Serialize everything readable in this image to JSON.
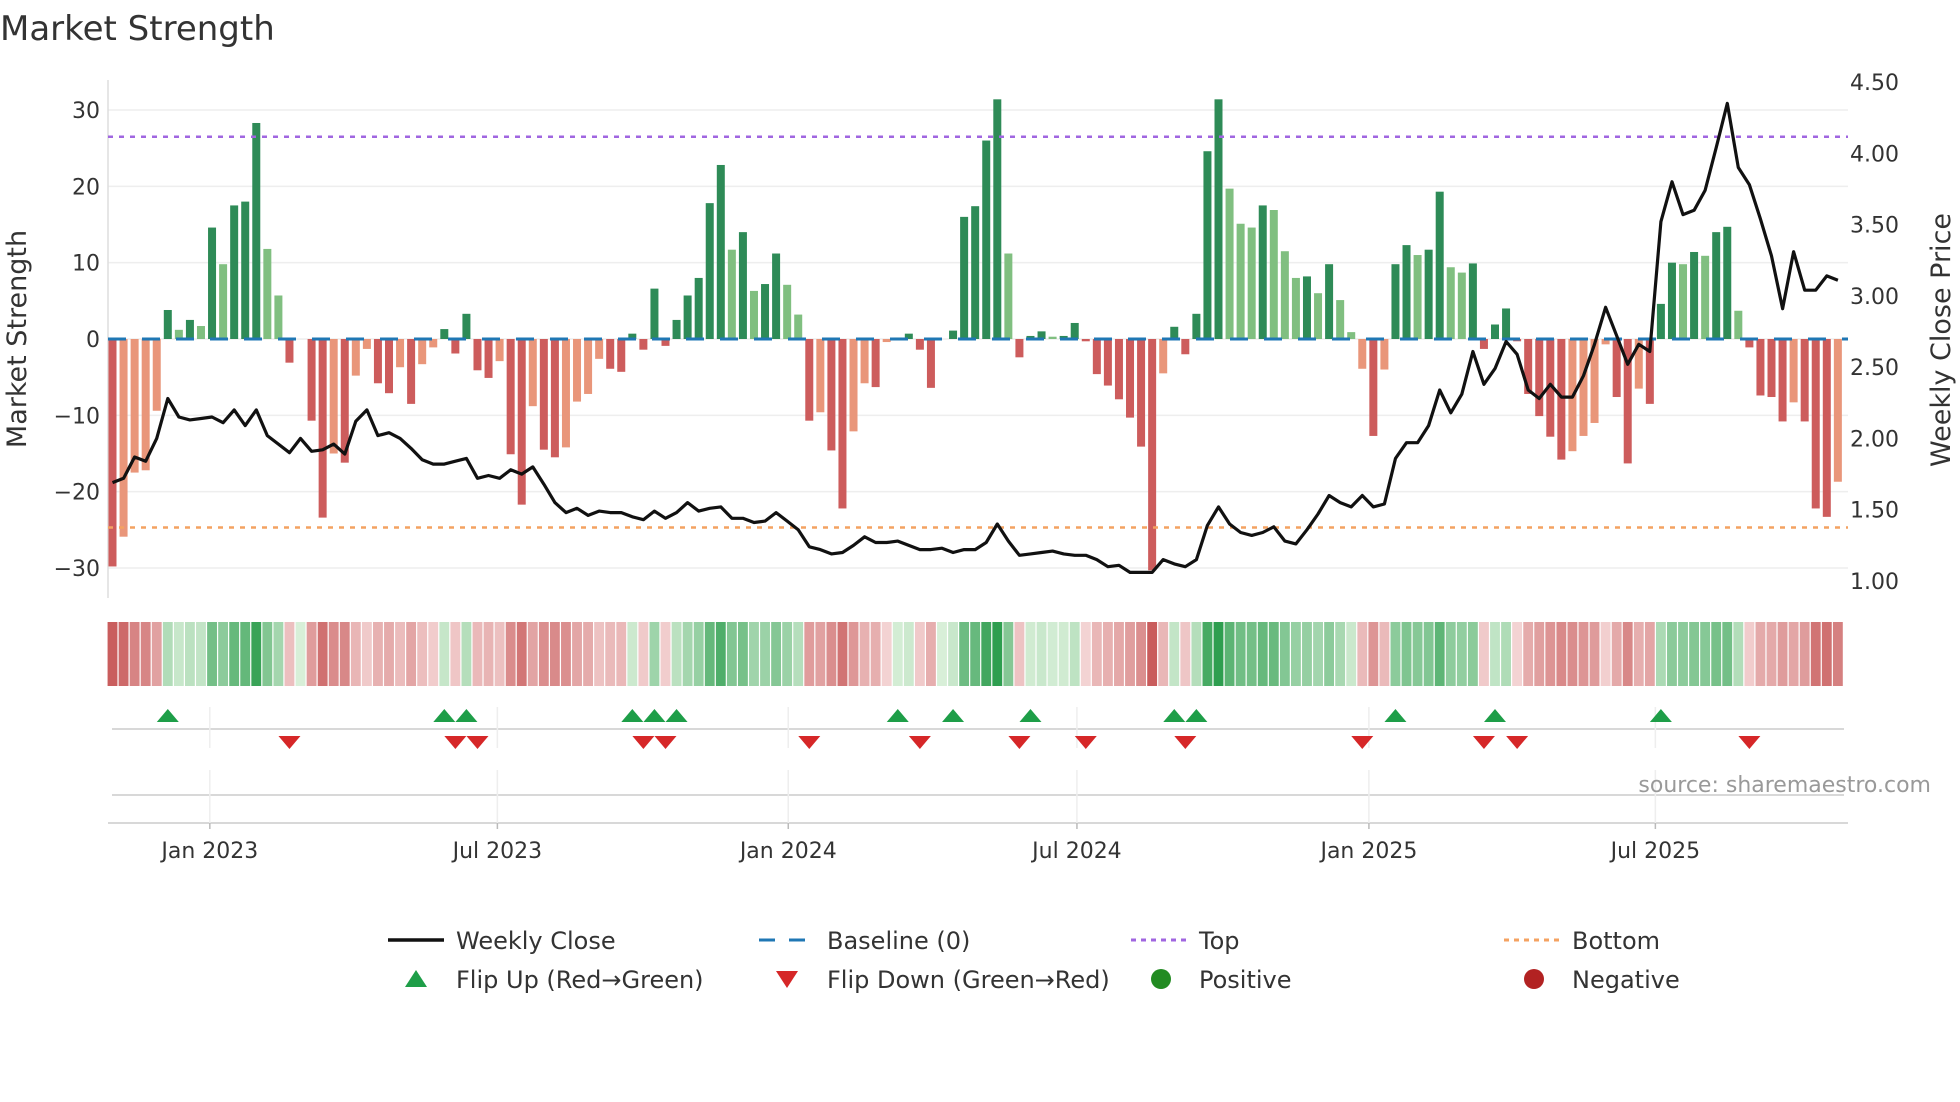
{
  "title": "Market Strength",
  "source": "source: sharemaestro.com",
  "colors": {
    "strong_green": "#2e8b57",
    "weak_green": "#80bf80",
    "strong_red": "#cd5c5c",
    "weak_red": "#e9967a",
    "baseline": "#1f77b4",
    "top": "#a066e0",
    "bottom": "#f4a261",
    "close": "#111111",
    "flip_up": "#1e9e48",
    "flip_down": "#d62728",
    "positive": "#228b22",
    "negative": "#b22222"
  },
  "chart_data": {
    "type": "bar",
    "title": "Market Strength",
    "ylabel": "Market Strength",
    "y2label": "Weekly Close Price",
    "ylim": [
      -33,
      32
    ],
    "y2lim": [
      0.9,
      4.6
    ],
    "yticks": [
      30,
      20,
      10,
      0,
      -10,
      -20,
      -30
    ],
    "y2ticks": [
      "1.00",
      "1.50",
      "2.00",
      "2.50",
      "3.00",
      "3.50",
      "4.00",
      "4.50"
    ],
    "xticks": [
      {
        "label": "Jan 2023",
        "week": 8.8
      },
      {
        "label": "Jul 2023",
        "week": 34.8
      },
      {
        "label": "Jan 2024",
        "week": 61.1
      },
      {
        "label": "Jul 2024",
        "week": 87.2
      },
      {
        "label": "Jan 2025",
        "week": 113.6
      },
      {
        "label": "Jul 2025",
        "week": 139.5
      }
    ],
    "top_level": 26.5,
    "bottom_level": -24.7,
    "baseline": 0,
    "strength": [
      -29.8,
      -25.9,
      -17.5,
      -17.2,
      -9.4,
      3.8,
      1.2,
      2.5,
      1.7,
      14.6,
      9.8,
      17.5,
      18,
      28.3,
      11.8,
      5.7,
      -3.1,
      0,
      -10.7,
      -23.4,
      -15,
      -16.2,
      -4.8,
      -1.3,
      -5.8,
      -7.1,
      -3.7,
      -8.5,
      -3.3,
      -1.1,
      1.3,
      -1.9,
      3.3,
      -4.1,
      -5.1,
      -2.9,
      -15.1,
      -21.7,
      -8.8,
      -14.5,
      -15.5,
      -14.2,
      -8.2,
      -7.2,
      -2.6,
      -3.9,
      -4.3,
      0.7,
      -1.4,
      6.6,
      -0.9,
      2.5,
      5.7,
      8,
      17.8,
      22.8,
      11.7,
      14,
      6.3,
      7.2,
      11.2,
      7.1,
      3.2,
      -10.7,
      -9.6,
      -14.6,
      -22.2,
      -12.1,
      -5.8,
      -6.3,
      -0.4,
      0.2,
      0.7,
      -1.4,
      -6.4,
      0,
      1.1,
      16,
      17.4,
      26,
      31.4,
      11.2,
      -2.4,
      0.4,
      1,
      0.3,
      0.4,
      2.1,
      -0.3,
      -4.6,
      -6.1,
      -7.9,
      -10.3,
      -14.1,
      -30.3,
      -4.5,
      1.6,
      -2,
      3.3,
      24.6,
      31.4,
      19.7,
      15.1,
      14.6,
      17.5,
      16.9,
      11.5,
      8,
      8.2,
      6,
      9.8,
      5.1,
      0.9,
      -3.9,
      -12.7,
      -4,
      9.8,
      12.3,
      11,
      11.7,
      19.3,
      9.4,
      8.7,
      9.9,
      -1.3,
      1.9,
      4,
      -0.3,
      -7.2,
      -10.1,
      -12.8,
      -15.8,
      -14.7,
      -12.7,
      -11,
      -0.7,
      -7.6,
      -16.3,
      -6.5,
      -8.5,
      4.6,
      10,
      9.8,
      11.4,
      10.9,
      14,
      14.7,
      3.7,
      -1.1,
      -7.4,
      -7.6,
      -10.8,
      -8.3,
      -10.8,
      -22.2,
      -23.3,
      -18.7
    ],
    "strong_flags": "1000010101011100111101001101001111101101100001111111111101011001011001001111111110111011111111101111100010001010001011011001111111110000110111010110111101110",
    "weekly_close": [
      1.69,
      1.72,
      1.87,
      1.84,
      2.0,
      2.28,
      2.15,
      2.13,
      2.14,
      2.15,
      2.11,
      2.2,
      2.09,
      2.2,
      2.02,
      1.96,
      1.9,
      2.0,
      1.91,
      1.92,
      1.96,
      1.89,
      2.12,
      2.2,
      2.02,
      2.04,
      2.0,
      1.93,
      1.85,
      1.82,
      1.82,
      1.84,
      1.86,
      1.72,
      1.74,
      1.72,
      1.78,
      1.75,
      1.8,
      1.68,
      1.55,
      1.48,
      1.51,
      1.46,
      1.49,
      1.48,
      1.48,
      1.45,
      1.43,
      1.49,
      1.44,
      1.48,
      1.55,
      1.49,
      1.51,
      1.52,
      1.44,
      1.44,
      1.41,
      1.42,
      1.48,
      1.42,
      1.36,
      1.24,
      1.22,
      1.19,
      1.2,
      1.25,
      1.31,
      1.27,
      1.27,
      1.28,
      1.25,
      1.22,
      1.22,
      1.23,
      1.2,
      1.22,
      1.22,
      1.27,
      1.4,
      1.28,
      1.18,
      1.19,
      1.2,
      1.21,
      1.19,
      1.18,
      1.18,
      1.15,
      1.1,
      1.11,
      1.06,
      1.06,
      1.06,
      1.15,
      1.12,
      1.1,
      1.15,
      1.39,
      1.52,
      1.4,
      1.34,
      1.32,
      1.34,
      1.38,
      1.28,
      1.26,
      1.36,
      1.47,
      1.6,
      1.55,
      1.52,
      1.6,
      1.52,
      1.54,
      1.86,
      1.97,
      1.97,
      2.09,
      2.34,
      2.18,
      2.31,
      2.61,
      2.38,
      2.49,
      2.68,
      2.59,
      2.34,
      2.28,
      2.38,
      2.29,
      2.29,
      2.44,
      2.66,
      2.92,
      2.72,
      2.52,
      2.66,
      2.61,
      3.52,
      3.8,
      3.57,
      3.6,
      3.74,
      4.04,
      4.35,
      3.9,
      3.78,
      3.54,
      3.28,
      2.91,
      3.31,
      3.04,
      3.04,
      3.14,
      3.11
    ],
    "flip_up_weeks": [
      5,
      30,
      32,
      47,
      49,
      51,
      71,
      76,
      83,
      96,
      98,
      116,
      125,
      140
    ],
    "flip_down_weeks": [
      16,
      31,
      33,
      48,
      50,
      63,
      73,
      82,
      88,
      97,
      113,
      124,
      127,
      148
    ],
    "legend": {
      "placement": "bottom",
      "items": [
        {
          "label": "Weekly Close",
          "kind": "line"
        },
        {
          "label": "Baseline (0)",
          "kind": "dash"
        },
        {
          "label": "Top",
          "kind": "dot-top"
        },
        {
          "label": "Bottom",
          "kind": "dot-bottom"
        },
        {
          "label": "Flip Up (Red→Green)",
          "kind": "tri-up"
        },
        {
          "label": "Flip Down (Green→Red)",
          "kind": "tri-down"
        },
        {
          "label": "Positive",
          "kind": "circle-pos"
        },
        {
          "label": "Negative",
          "kind": "circle-neg"
        }
      ]
    }
  }
}
